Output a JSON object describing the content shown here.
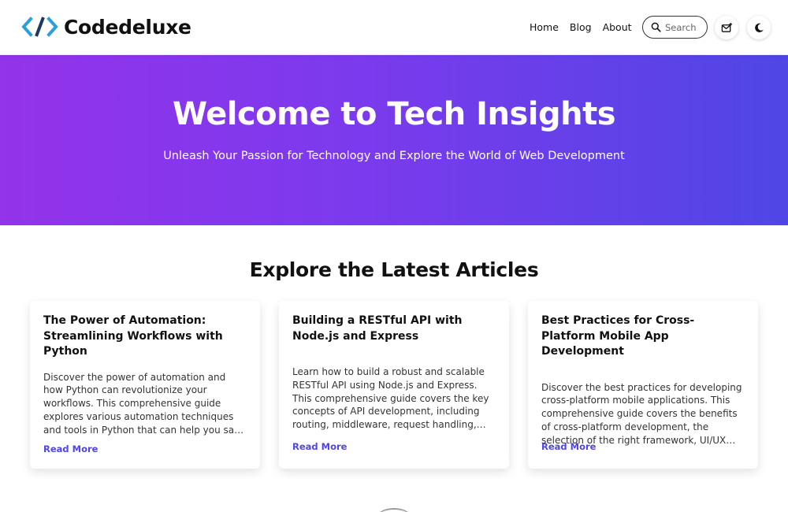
{
  "brand": {
    "name": "Codedeluxe",
    "logo_icon": "code-brackets-icon",
    "colors": {
      "dark": "#1e3a5f",
      "light": "#2b9fd9"
    }
  },
  "nav": {
    "items": [
      {
        "label": "Home"
      },
      {
        "label": "Blog"
      },
      {
        "label": "About"
      }
    ]
  },
  "search": {
    "placeholder": "Search",
    "icon": "search-icon"
  },
  "actions": {
    "mail_icon": "mail-add-icon",
    "theme_icon": "moon-icon"
  },
  "hero": {
    "title": "Welcome to Tech Insights",
    "subtitle": "Unleash Your Passion for Technology and Explore the World of Web Development",
    "gradient": [
      "#9333ea",
      "#4f46e5"
    ]
  },
  "articles": {
    "heading": "Explore the Latest Articles",
    "items": [
      {
        "title": "The Power of Automation: Streamlining Workflows with Python",
        "excerpt": "Discover the power of automation and how Python can revolutionize your workflows. This comprehensive guide explores various automation techniques and tools in Python that can help you save time, increase…",
        "cta": "Read More"
      },
      {
        "title": "Building a RESTful API with Node.js and Express",
        "excerpt": "Learn how to build a robust and scalable RESTful API using Node.js and Express. This comprehensive guide covers the key concepts of API development, including routing, middleware, request handling,…",
        "cta": "Read More"
      },
      {
        "title": "Best Practices for Cross-Platform Mobile App Development",
        "excerpt": "Discover the best practices for developing cross-platform mobile applications. This comprehensive guide covers the benefits of cross-platform development, the selection of the right framework, UI/UX…",
        "cta": "Read More"
      }
    ],
    "accent": "#4f46e5"
  }
}
